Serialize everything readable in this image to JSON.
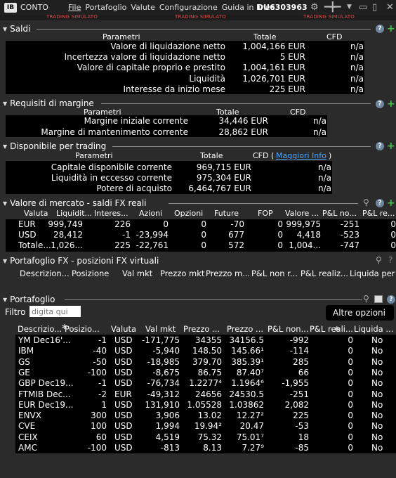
{
  "titlebar": {
    "logo": "IB",
    "app_name": "CONTO",
    "menu": [
      "File",
      "Portafoglio",
      "Valute",
      "Configurazione",
      "Guida in linea"
    ],
    "account": "DU6303963",
    "sim_label": "TRADING SIMULATO"
  },
  "saldi": {
    "title": "Saldi",
    "headers": [
      "Parametri",
      "Totale",
      "CFD"
    ],
    "rows": [
      {
        "label": "Valore di liquidazione netto",
        "total": "1,004,166 EUR",
        "cfd": "n/a"
      },
      {
        "label": "Incertezza valore di liquidazione netto",
        "total": "5 EUR",
        "cfd": "n/a"
      },
      {
        "label": "Valore di capitale proprio e prestito",
        "total": "1,004,161 EUR",
        "cfd": "n/a"
      },
      {
        "label": "Liquidità",
        "total": "1,026,701 EUR",
        "cfd": "n/a"
      },
      {
        "label": "Interesse da inizio mese",
        "total": "225 EUR",
        "cfd": "n/a"
      }
    ]
  },
  "margine": {
    "title": "Requisiti di margine",
    "headers": [
      "Parametri",
      "Totale",
      "CFD"
    ],
    "rows": [
      {
        "label": "Margine iniziale corrente",
        "total": "34,446 EUR",
        "cfd": "n/a"
      },
      {
        "label": "Margine di mantenimento corrente",
        "total": "28,862 EUR",
        "cfd": "n/a"
      }
    ]
  },
  "disponibile": {
    "title": "Disponibile per trading",
    "headers": [
      "Parametri",
      "Totale",
      "CFD ("
    ],
    "more_info": "Maggiori Info",
    "more_close": ")",
    "rows": [
      {
        "label": "Capitale disponibile corrente",
        "total": "969,715 EUR",
        "cfd": "n/a"
      },
      {
        "label": "Liquidità in eccesso corrente",
        "total": "975,304 EUR",
        "cfd": "n/a"
      },
      {
        "label": "Potere di acquisto",
        "total": "6,464,767 EUR",
        "cfd": "n/a"
      }
    ]
  },
  "mercato": {
    "title": "Valore di mercato - saldi FX reali",
    "headers": [
      "Valuta",
      "Liquidit...",
      "Interes...",
      "Azioni",
      "Opzioni",
      "Future",
      "FOP",
      "Valore ...",
      "P&L no...",
      "P&L re..."
    ],
    "rows": [
      [
        "EUR",
        "999,749",
        "226",
        "0",
        "0",
        "-70",
        "0",
        "999,975",
        "-251",
        "0"
      ],
      [
        "USD",
        "28,412",
        "-1",
        "-23,994",
        "0",
        "677",
        "0",
        "4,418",
        "-523",
        "0"
      ],
      [
        "Totale...",
        "1,026...",
        "225",
        "-22,761",
        "0",
        "572",
        "0",
        "1,004...",
        "-747",
        "0"
      ]
    ]
  },
  "fx": {
    "title": "Portafoglio FX - posizioni FX virtuali",
    "headers": [
      "Descrizion...",
      "Posizione",
      "Val mkt",
      "Prezzo mkt",
      "Prezzo m...",
      "P&L non r...",
      "P&L realiz...",
      "Liquida per"
    ]
  },
  "portafoglio": {
    "title": "Portafoglio",
    "filter_label": "Filtro",
    "filter_placeholder": "digita qui",
    "more_options": "Altre opzioni",
    "headers": [
      "Descrizio...",
      "Posizio...",
      "Valuta",
      "Val mkt",
      "Prezzo ...",
      "Prezzo ...",
      "P&L non...",
      "P&L reali...",
      "Liquida ..."
    ],
    "rows": [
      [
        "YM Dec16'...",
        "-1",
        "USD",
        "-171,775",
        "34355",
        "34156.5",
        "-992",
        "0",
        "No"
      ],
      [
        "IBM",
        "-40",
        "USD",
        "-5,940",
        "148.50",
        "145.66¹",
        "-114",
        "0",
        "No"
      ],
      [
        "GS",
        "-50",
        "USD",
        "-18,985",
        "379.70",
        "385.39¹",
        "285",
        "0",
        "No"
      ],
      [
        "GE",
        "-100",
        "USD",
        "-8,675",
        "86.75",
        "87.40⁷",
        "66",
        "0",
        "No"
      ],
      [
        "GBP Dec19...",
        "-1",
        "USD",
        "-76,734",
        "1.2277⁴",
        "1.1964⁶",
        "-1,955",
        "0",
        "No"
      ],
      [
        "FTMIB Dec...",
        "-2",
        "EUR",
        "-49,312",
        "24656",
        "24530.5",
        "-251",
        "0",
        "No"
      ],
      [
        "EUR Dec19...",
        "1",
        "USD",
        "131,910",
        "1.05528",
        "1.03862",
        "2,082",
        "0",
        "No"
      ],
      [
        "ENVX",
        "300",
        "USD",
        "3,906",
        "13.02",
        "12.27²",
        "225",
        "0",
        "No"
      ],
      [
        "CVE",
        "100",
        "USD",
        "1,994",
        "19.94²",
        "20.47",
        "-53",
        "0",
        "No"
      ],
      [
        "CEIX",
        "60",
        "USD",
        "4,519",
        "75.32",
        "75.01⁷",
        "18",
        "0",
        "No"
      ],
      [
        "AMC",
        "-100",
        "USD",
        "-813",
        "8.13",
        "7.27⁹",
        "-85",
        "0",
        "No"
      ]
    ]
  },
  "colors": {
    "negative": "#ff4c4c",
    "positive": "#38d538",
    "link": "#4aa3ff",
    "accent_plus": "#4cc24c"
  }
}
